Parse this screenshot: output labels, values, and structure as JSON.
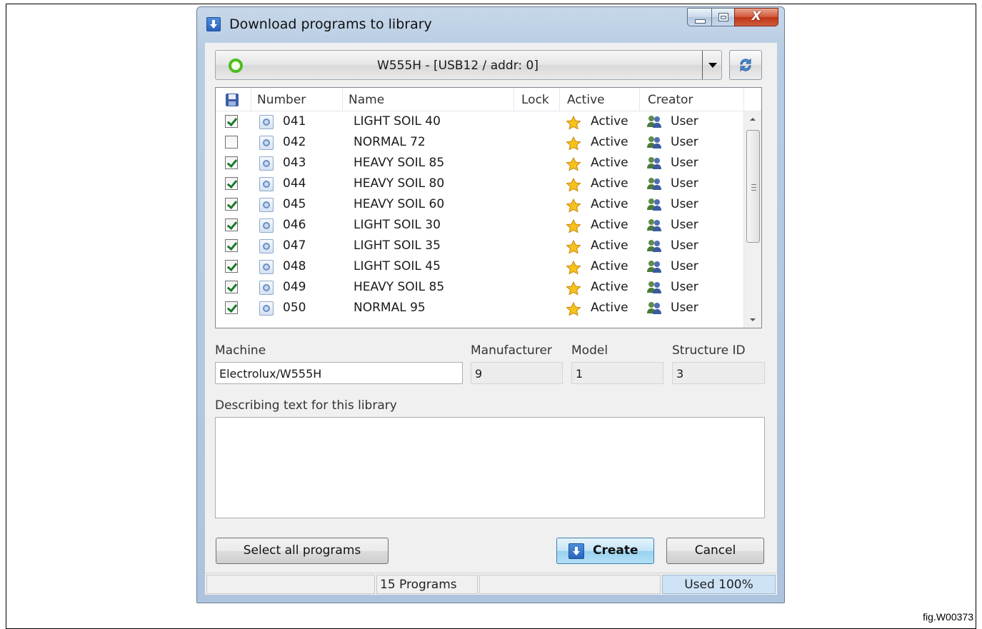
{
  "window": {
    "title": "Download programs to library",
    "caption_close": "X"
  },
  "device_selector": {
    "value": "W555H - [USB12 / addr: 0]",
    "status_color": "#4cbd1f"
  },
  "program_list": {
    "columns": [
      "Number",
      "Name",
      "Lock",
      "Active",
      "Creator"
    ],
    "rows": [
      {
        "checked": true,
        "number": "041",
        "name": "LIGHT SOIL 40",
        "lock": "",
        "active": "Active",
        "creator": "User"
      },
      {
        "checked": false,
        "number": "042",
        "name": "NORMAL 72",
        "lock": "",
        "active": "Active",
        "creator": "User"
      },
      {
        "checked": true,
        "number": "043",
        "name": "HEAVY SOIL 85",
        "lock": "",
        "active": "Active",
        "creator": "User"
      },
      {
        "checked": true,
        "number": "044",
        "name": "HEAVY SOIL 80",
        "lock": "",
        "active": "Active",
        "creator": "User"
      },
      {
        "checked": true,
        "number": "045",
        "name": "HEAVY SOIL 60",
        "lock": "",
        "active": "Active",
        "creator": "User"
      },
      {
        "checked": true,
        "number": "046",
        "name": "LIGHT SOIL 30",
        "lock": "",
        "active": "Active",
        "creator": "User"
      },
      {
        "checked": true,
        "number": "047",
        "name": "LIGHT SOIL 35",
        "lock": "",
        "active": "Active",
        "creator": "User"
      },
      {
        "checked": true,
        "number": "048",
        "name": "LIGHT SOIL 45",
        "lock": "",
        "active": "Active",
        "creator": "User"
      },
      {
        "checked": true,
        "number": "049",
        "name": "HEAVY SOIL 85",
        "lock": "",
        "active": "Active",
        "creator": "User"
      },
      {
        "checked": true,
        "number": "050",
        "name": "NORMAL 95",
        "lock": "",
        "active": "Active",
        "creator": "User"
      }
    ]
  },
  "fields": {
    "machine_label": "Machine",
    "machine_value": "Electrolux/W555H",
    "manufacturer_label": "Manufacturer",
    "manufacturer_value": "9",
    "model_label": "Model",
    "model_value": "1",
    "structure_label": "Structure ID",
    "structure_value": "3",
    "description_label": "Describing text for this library",
    "description_value": ""
  },
  "buttons": {
    "select_all": "Select all programs",
    "create": "Create",
    "cancel": "Cancel"
  },
  "status": {
    "programs": "15 Programs",
    "used": "Used 100%"
  },
  "figure_label": "fig.W00373",
  "icons": {
    "title": "download-arrow-icon",
    "refresh": "refresh-icon",
    "program": "program-file-icon",
    "active": "star-icon",
    "creator": "user-group-icon",
    "save": "save-icon"
  }
}
